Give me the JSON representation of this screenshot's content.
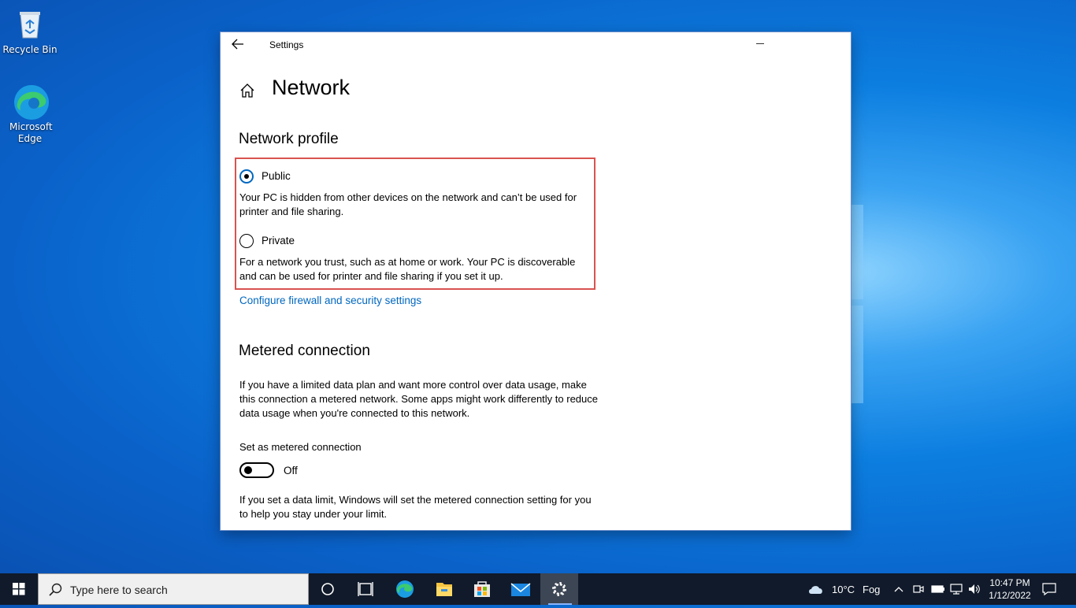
{
  "desktop": {
    "icons": [
      {
        "label": "Recycle Bin"
      },
      {
        "label": "Microsoft Edge"
      }
    ]
  },
  "window": {
    "title": "Settings",
    "page_title": "Network",
    "network_profile": {
      "heading": "Network profile",
      "public_label": "Public",
      "public_desc": "Your PC is hidden from other devices on the network and can’t be used for printer and file sharing.",
      "private_label": "Private",
      "private_desc": "For a network you trust, such as at home or work. Your PC is discoverable and can be used for printer and file sharing if you set it up.",
      "selected": "Public",
      "firewall_link": "Configure firewall and security settings"
    },
    "metered": {
      "heading": "Metered connection",
      "desc": "If you have a limited data plan and want more control over data usage, make this connection a metered network. Some apps might work differently to reduce data usage when you're connected to this network.",
      "toggle_label": "Set as metered connection",
      "toggle_state": "Off",
      "limit_desc": "If you set a data limit, Windows will set the metered connection setting for you to help you stay under your limit."
    }
  },
  "taskbar": {
    "search_placeholder": "Type here to search",
    "weather": "10°C",
    "weather_desc": "Fog",
    "time": "10:47 PM",
    "date": "1/12/2022"
  },
  "colors": {
    "accent": "#0067c0",
    "highlight_border": "#d9534f",
    "taskbar_bg": "#101a2a"
  }
}
